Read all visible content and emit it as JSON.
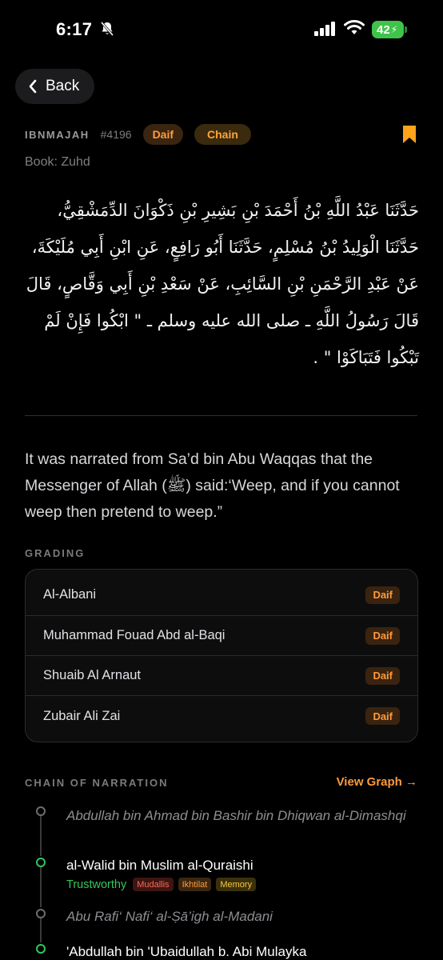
{
  "status_bar": {
    "time": "6:17",
    "battery": "42",
    "icons": [
      "bell-slash-icon",
      "signal-bars-icon",
      "wifi-icon",
      "battery-charging-icon"
    ]
  },
  "nav": {
    "back_label": "Back",
    "icon": "chevron-left-icon"
  },
  "hadith": {
    "collection": "IBNMAJAH",
    "number": "#4196",
    "grade_pill": "Daif",
    "chain_pill": "Chain",
    "bookmark_icon": "bookmark-icon",
    "book": "Book: Zuhd",
    "arabic": "حَدَّثَنَا عَبْدُ اللَّهِ بْنُ أَحْمَدَ بْنِ بَشِيرِ بْنِ ذَكْوَانَ الدِّمَشْقِيُّ، حَدَّثَنَا الْوَلِيدُ بْنُ مُسْلِمٍ، حَدَّثَنَا أَبُو رَافِعٍ، عَنِ ابْنِ أَبِي مُلَيْكَةَ، عَنْ عَبْدِ الرَّحْمَنِ بْنِ السَّائِبِ، عَنْ سَعْدِ بْنِ أَبِي وَقَّاصٍ، قَالَ قَالَ رَسُولُ اللَّهِ ـ صلى الله عليه وسلم ـ \" ابْكُوا فَإِنْ لَمْ تَبْكُوا فَتَبَاكَوْا \" .",
    "english": "It was narrated from Sa’d bin Abu Waqqas that the Messenger of Allah (ﷺ) said:‘Weep, and if you cannot weep then pretend to weep.”"
  },
  "grading": {
    "label": "GRADING",
    "rows": [
      {
        "name": "Al-Albani",
        "grade": "Daif"
      },
      {
        "name": "Muhammad Fouad Abd al-Baqi",
        "grade": "Daif"
      },
      {
        "name": "Shuaib Al Arnaut",
        "grade": "Daif"
      },
      {
        "name": "Zubair Ali Zai",
        "grade": "Daif"
      }
    ]
  },
  "chain": {
    "label": "CHAIN OF NARRATION",
    "view_graph": "View Graph →",
    "narrators": [
      {
        "name": "Abdullah bin Ahmad bin Bashir bin Dhiqwan al-Dimashqi"
      },
      {
        "name": "al-Walid bin Muslim al-Quraishi",
        "reliability": "Trustworthy",
        "tags": [
          "Mudallis",
          "Ikhtilat",
          "Memory"
        ]
      },
      {
        "name": "Abu Rafi‘ Nafi‘ al-Ṣā’igh al-Madani"
      },
      {
        "name": "'Abdullah bin 'Ubaidullah b. Abi Mulayka"
      }
    ]
  }
}
